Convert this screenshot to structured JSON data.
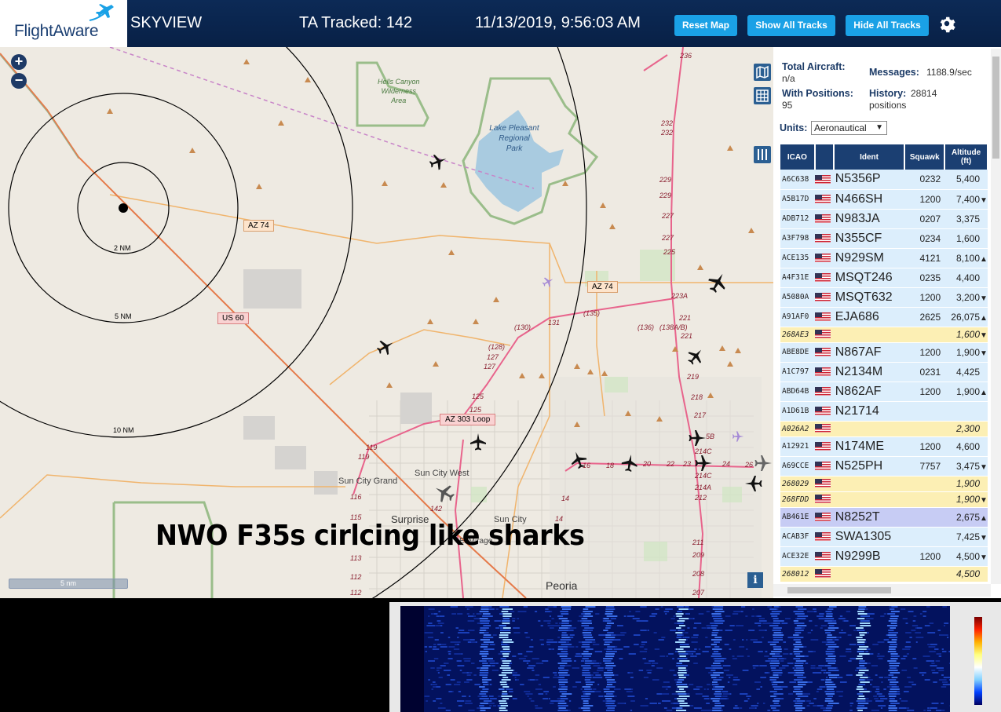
{
  "header": {
    "logo_text": "FlightAware",
    "app_name": "SKYVIEW",
    "tracked": "TA Tracked: 142",
    "datetime": "11/13/2019, 9:56:03 AM",
    "buttons": {
      "reset": "Reset Map",
      "show_all": "Show All Tracks",
      "hide_all": "Hide All Tracks"
    },
    "icons": {
      "settings": "gear-icon",
      "logo": "plane-icon"
    }
  },
  "map": {
    "zoom_in": "+",
    "zoom_out": "−",
    "scale_label": "5 nm",
    "info": "i",
    "caption": "NWO F35s cirlcing like sharks",
    "range_rings": [
      "2 NM",
      "5 NM",
      "10 NM"
    ],
    "place_labels": [
      "Hells Canyon",
      "Wilderness",
      "Area",
      "Lake Pleasant",
      "Regional",
      "Park",
      "Sun City Grand",
      "Sun City West",
      "Surprise",
      "Sun City",
      "El Mirage",
      "Peoria"
    ],
    "road_shields": [
      "AZ 74",
      "AZ 74",
      "US 60",
      "AZ 303 Loop"
    ],
    "road_numbers": [
      "236",
      "232",
      "232",
      "229",
      "229",
      "227",
      "227",
      "225",
      "223A",
      "221",
      "221",
      "219",
      "218",
      "217",
      "(130)",
      "131",
      "(135)",
      "(136)",
      "(138A/B)",
      "(128)",
      "127",
      "127",
      "125",
      "125",
      "119",
      "119",
      "116",
      "115",
      "113",
      "112",
      "112",
      "142",
      "14",
      "14",
      "16",
      "18",
      "20",
      "22",
      "23",
      "24",
      "26",
      "214C",
      "214C",
      "214A",
      "212",
      "211",
      "209",
      "208",
      "207",
      "5B"
    ]
  },
  "panel": {
    "total_aircraft_label": "Total Aircraft:",
    "total_aircraft_value": "n/a",
    "messages_label": "Messages:",
    "messages_value": "1188.9/sec",
    "with_positions_label": "With Positions:",
    "with_positions_value": "95",
    "history_label": "History:",
    "history_value": "28814",
    "history_unit": "positions",
    "units_label": "Units:",
    "units_value": "Aeronautical",
    "columns": [
      "ICAO",
      "",
      "Ident",
      "Squawk",
      "Altitude (ft)"
    ],
    "rows": [
      {
        "icao": "A6C638",
        "ident": "N5356P",
        "squawk": "0232",
        "alt": "5,400",
        "trend": "",
        "kind": "norm"
      },
      {
        "icao": "A5B17D",
        "ident": "N466SH",
        "squawk": "1200",
        "alt": "7,400",
        "trend": "▼",
        "kind": "norm"
      },
      {
        "icao": "ADB712",
        "ident": "N983JA",
        "squawk": "0207",
        "alt": "3,375",
        "trend": "",
        "kind": "norm"
      },
      {
        "icao": "A3F798",
        "ident": "N355CF",
        "squawk": "0234",
        "alt": "1,600",
        "trend": "",
        "kind": "norm"
      },
      {
        "icao": "ACE135",
        "ident": "N929SM",
        "squawk": "4121",
        "alt": "8,100",
        "trend": "▲",
        "kind": "norm"
      },
      {
        "icao": "A4F31E",
        "ident": "MSQT246",
        "squawk": "0235",
        "alt": "4,400",
        "trend": "",
        "kind": "norm"
      },
      {
        "icao": "A5080A",
        "ident": "MSQT632",
        "squawk": "1200",
        "alt": "3,200",
        "trend": "▼",
        "kind": "norm"
      },
      {
        "icao": "A91AF0",
        "ident": "EJA686",
        "squawk": "2625",
        "alt": "26,075",
        "trend": "▲",
        "kind": "norm"
      },
      {
        "icao": "268AE3",
        "ident": "",
        "squawk": "",
        "alt": "1,600",
        "trend": "▼",
        "kind": "mlat"
      },
      {
        "icao": "ABE8DE",
        "ident": "N867AF",
        "squawk": "1200",
        "alt": "1,900",
        "trend": "▼",
        "kind": "norm"
      },
      {
        "icao": "A1C797",
        "ident": "N2134M",
        "squawk": "0231",
        "alt": "4,425",
        "trend": "",
        "kind": "norm"
      },
      {
        "icao": "ABD64B",
        "ident": "N862AF",
        "squawk": "1200",
        "alt": "1,900",
        "trend": "▲",
        "kind": "norm"
      },
      {
        "icao": "A1D61B",
        "ident": "N21714",
        "squawk": "",
        "alt": "",
        "trend": "",
        "kind": "norm"
      },
      {
        "icao": "A026A2",
        "ident": "",
        "squawk": "",
        "alt": "2,300",
        "trend": "",
        "kind": "mlat"
      },
      {
        "icao": "A12921",
        "ident": "N174ME",
        "squawk": "1200",
        "alt": "4,600",
        "trend": "",
        "kind": "norm"
      },
      {
        "icao": "A69CCE",
        "ident": "N525PH",
        "squawk": "7757",
        "alt": "3,475",
        "trend": "▼",
        "kind": "norm"
      },
      {
        "icao": "268029",
        "ident": "",
        "squawk": "",
        "alt": "1,900",
        "trend": "",
        "kind": "mlat"
      },
      {
        "icao": "268FDD",
        "ident": "",
        "squawk": "",
        "alt": "1,900",
        "trend": "▼",
        "kind": "mlat"
      },
      {
        "icao": "AB461E",
        "ident": "N8252T",
        "squawk": "",
        "alt": "2,675",
        "trend": "▲",
        "kind": "sel"
      },
      {
        "icao": "ACAB3F",
        "ident": "SWA1305",
        "squawk": "",
        "alt": "7,425",
        "trend": "▼",
        "kind": "norm"
      },
      {
        "icao": "ACE32E",
        "ident": "N9299B",
        "squawk": "1200",
        "alt": "4,500",
        "trend": "▼",
        "kind": "norm"
      },
      {
        "icao": "268012",
        "ident": "",
        "squawk": "",
        "alt": "4,500",
        "trend": "",
        "kind": "mlat"
      }
    ]
  }
}
